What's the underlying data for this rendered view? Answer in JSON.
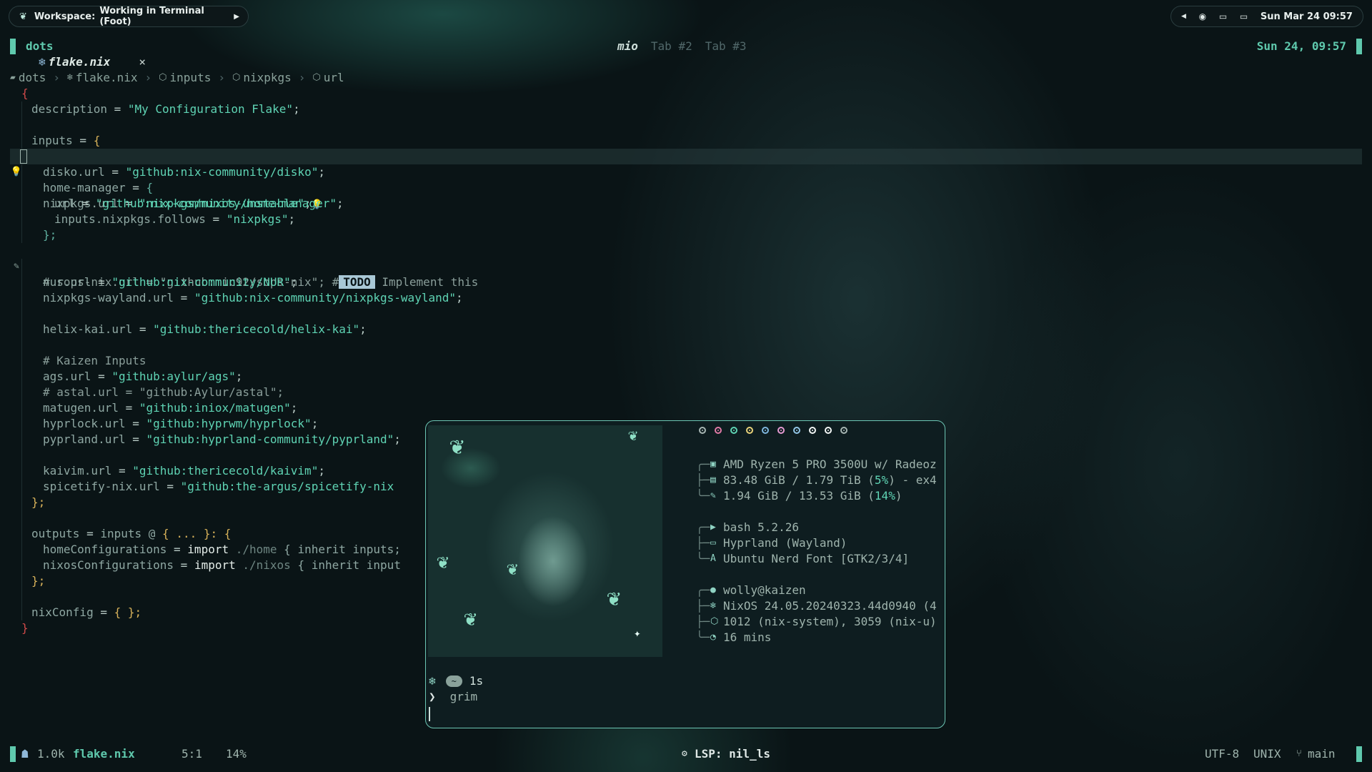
{
  "topbar": {
    "workspace_label": "Workspace:",
    "workspace_title": "Working in Terminal (Foot)",
    "date_time": "Sun Mar 24  09:57"
  },
  "helix": {
    "session_name": "dots",
    "tabs": [
      {
        "label": "mio",
        "active": true
      },
      {
        "label": "Tab #2",
        "active": false
      },
      {
        "label": "Tab #3",
        "active": false
      }
    ],
    "clock": "Sun 24, 09:57",
    "open_file": "flake.nix",
    "close_glyph": "×",
    "breadcrumb": [
      "dots",
      "flake.nix",
      "inputs",
      "nixpkgs",
      "url"
    ],
    "code": {
      "l1": "{",
      "l2_key": "description",
      "l2_str": "\"My Configuration Flake\"",
      "l4_key": "inputs",
      "l5_key": "nixpkgs.url",
      "l5_str": "\"nixpkgs/nixos-unstable\"",
      "l6_key": "disko.url",
      "l6_str": "\"github:nix-community/disko\"",
      "l7_key": "home-manager",
      "l8_key": "url",
      "l8_str": "\"github:nix-community/home-manager\"",
      "l9_key": "inputs.nixpkgs.follows",
      "l9_str": "\"nixpkgs\"",
      "l10": "};",
      "l11_comment": "# sops-nix.url = \"github:mic92/sops-nix\"; #",
      "l11_todo": "TODO",
      "l11_rest": " Implement this",
      "l13_key": "nur.url",
      "l13_str": "\"github:nix-community/NUR\"",
      "l14_key": "nixpkgs-wayland.url",
      "l14_str": "\"github:nix-community/nixpkgs-wayland\"",
      "l16_key": "helix-kai.url",
      "l16_str": "\"github:thericecold/helix-kai\"",
      "l18_comment": "# Kaizen Inputs",
      "l19_key": "ags.url",
      "l19_str": "\"github:aylur/ags\"",
      "l20_comment": "# astal.url = \"github:Aylur/astal\";",
      "l21_key": "matugen.url",
      "l21_str": "\"github:iniox/matugen\"",
      "l22_key": "hyprlock.url",
      "l22_str": "\"github:hyprwm/hyprlock\"",
      "l23_key": "pyprland.url",
      "l23_str": "\"github:hyprland-community/pyprland\"",
      "l25_key": "kaivim.url",
      "l25_str": "\"github:thericecold/kaivim\"",
      "l26_key": "spicetify-nix.url",
      "l26_str": "\"github:the-argus/spicetify-nix",
      "l27": "};",
      "l29_key": "outputs",
      "l29_mid": "inputs @",
      "l29_args": "{ ... }:",
      "l30_key": "homeConfigurations",
      "l30_kw": "import",
      "l30_path": "./home",
      "l30_rest": "{ inherit inputs;",
      "l31_key": "nixosConfigurations",
      "l31_kw": "import",
      "l31_path": "./nixos",
      "l31_rest": "{ inherit input",
      "l32": "};",
      "l34_key": "nixConfig",
      "l34_val": "{ };",
      "l35": "}"
    },
    "status": {
      "size": "1.0k",
      "file": "flake.nix",
      "position": "5:1",
      "percent": "14%",
      "lsp": "LSP: nil_ls",
      "encoding": "UTF-8",
      "line_ending": "UNIX",
      "branch": "main"
    }
  },
  "terminal": {
    "palette": [
      "#a7b6b3",
      "#e07aa6",
      "#5fd4b4",
      "#e8d27a",
      "#7fb6de",
      "#e59ad2",
      "#93c6e6",
      "#f2f6f5",
      "#f2f6f5",
      "#a7b6b3"
    ],
    "cpu": "AMD Ryzen 5 PRO 3500U w/ Radeoz",
    "disk_pre": "83.48 GiB / 1.79 TiB (",
    "disk_pct": "5%",
    "disk_post": ") - ex4",
    "mem_pre": "1.94 GiB / 13.53 GiB (",
    "mem_pct": "14%",
    "mem_post": ")",
    "shell": "bash 5.2.26",
    "wm": "Hyprland (Wayland)",
    "font": "Ubuntu Nerd Font [GTK2/3/4]",
    "user": "wolly@kaizen",
    "os": "NixOS 24.05.20240323.44d0940 (4",
    "packages": "1012 (nix-system), 3059 (nix-u)",
    "uptime": "16 mins",
    "prompt_dir": "~",
    "prompt_time": "1s",
    "prompt_arrow": "❯",
    "command": "grim"
  },
  "colors": {
    "accent": "#5fc9ad",
    "string": "#5fd4b4",
    "brace": "#d8b25a",
    "error_brace": "#d14a4a",
    "todo_bg": "#a9c8d6"
  }
}
